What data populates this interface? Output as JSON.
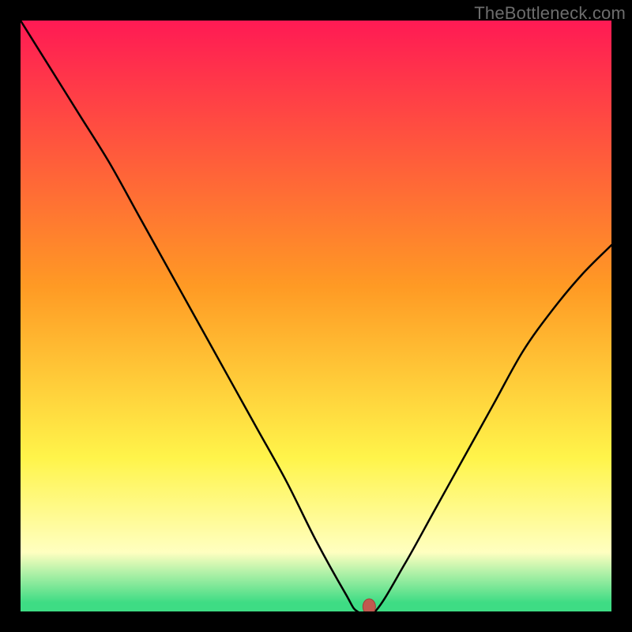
{
  "watermark": "TheBottleneck.com",
  "colors": {
    "frame": "#000000",
    "gradient_top": "#ff1a54",
    "gradient_mid1": "#ff9a24",
    "gradient_mid2": "#fff44a",
    "gradient_pale": "#ffffc0",
    "gradient_green": "#3edc84",
    "curve": "#000000",
    "marker_fill": "#c1594f",
    "marker_stroke": "#9d4038"
  },
  "chart_data": {
    "type": "line",
    "title": "",
    "xlabel": "",
    "ylabel": "",
    "xlim": [
      0,
      100
    ],
    "ylim": [
      0,
      100
    ],
    "x": [
      0,
      5,
      10,
      15,
      20,
      25,
      30,
      35,
      40,
      45,
      50,
      55,
      57,
      60,
      65,
      70,
      75,
      80,
      85,
      90,
      95,
      100
    ],
    "values": [
      100,
      92,
      84,
      76,
      67,
      58,
      49,
      40,
      31,
      22,
      12,
      3,
      0,
      0,
      8,
      17,
      26,
      35,
      44,
      51,
      57,
      62
    ],
    "marker": {
      "x": 59,
      "y": 0
    },
    "notes": "y is bottleneck percentage; curve falls to a flat zero near x≈57–60 then rises with diminishing slope."
  }
}
